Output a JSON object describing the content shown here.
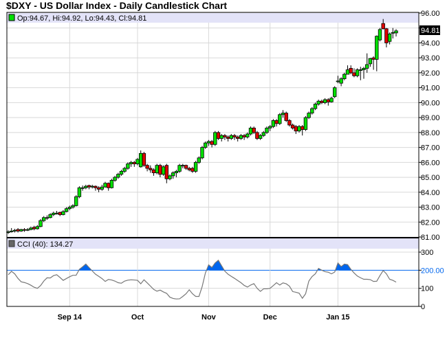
{
  "title": "$DXY - US Dollar Index - Daily Candlestick Chart",
  "colors": {
    "up": "#00e000",
    "down": "#e00000",
    "cci_line": "#777777",
    "cci_fill": "#0066ee",
    "ref_line": "#0066ee",
    "legend_bg": "#e3e3f8",
    "grid": "#d8d8d8"
  },
  "chart_data": [
    {
      "type": "candlestick",
      "title": "$DXY - US Dollar Index - Daily Candlestick Chart",
      "legend": "Op:94.67, Hi:94.92, Lo:94.43, Cl:94.81",
      "last_price_label": "94.81",
      "last_price": 94.81,
      "ylim": [
        81,
        96
      ],
      "yticks": [
        "81.00",
        "82.00",
        "83.00",
        "84.00",
        "85.00",
        "86.00",
        "87.00",
        "88.00",
        "89.00",
        "90.00",
        "91.00",
        "92.00",
        "93.00",
        "94.00",
        "95.00",
        "96.00"
      ],
      "grid": true,
      "xticks": [
        {
          "label": "Sep 14",
          "index": 19
        },
        {
          "label": "Oct",
          "index": 40
        },
        {
          "label": "Nov",
          "index": 62
        },
        {
          "label": "Dec",
          "index": 81
        },
        {
          "label": "Jan 15",
          "index": 102
        }
      ],
      "ohlc": [
        [
          81.3,
          81.45,
          81.2,
          81.35
        ],
        [
          81.35,
          81.6,
          81.3,
          81.4
        ],
        [
          81.4,
          81.55,
          81.3,
          81.45
        ],
        [
          81.5,
          81.6,
          81.3,
          81.4
        ],
        [
          81.4,
          81.55,
          81.35,
          81.5
        ],
        [
          81.5,
          81.6,
          81.35,
          81.45
        ],
        [
          81.45,
          81.6,
          81.4,
          81.5
        ],
        [
          81.5,
          81.7,
          81.45,
          81.6
        ],
        [
          81.65,
          81.75,
          81.45,
          81.55
        ],
        [
          81.55,
          81.8,
          81.5,
          81.7
        ],
        [
          81.7,
          82.2,
          81.65,
          82.1
        ],
        [
          82.1,
          82.4,
          82.0,
          82.3
        ],
        [
          82.3,
          82.45,
          82.15,
          82.3
        ],
        [
          82.3,
          82.6,
          82.25,
          82.5
        ],
        [
          82.5,
          82.7,
          82.4,
          82.6
        ],
        [
          82.6,
          82.75,
          82.5,
          82.6
        ],
        [
          82.65,
          82.7,
          82.4,
          82.5
        ],
        [
          82.5,
          82.8,
          82.45,
          82.7
        ],
        [
          82.7,
          83.0,
          82.65,
          82.9
        ],
        [
          82.9,
          83.1,
          82.8,
          83.0
        ],
        [
          83.0,
          83.2,
          82.9,
          83.1
        ],
        [
          83.1,
          83.8,
          83.05,
          83.7
        ],
        [
          83.7,
          84.4,
          83.6,
          84.3
        ],
        [
          84.3,
          84.45,
          84.1,
          84.3
        ],
        [
          84.3,
          84.5,
          84.2,
          84.4
        ],
        [
          84.45,
          84.5,
          84.2,
          84.35
        ],
        [
          84.35,
          84.5,
          84.25,
          84.4
        ],
        [
          84.4,
          84.45,
          84.1,
          84.3
        ],
        [
          84.3,
          84.4,
          84.0,
          84.2
        ],
        [
          84.2,
          84.5,
          84.1,
          84.35
        ],
        [
          84.35,
          84.7,
          84.3,
          84.6
        ],
        [
          84.6,
          84.65,
          84.1,
          84.3
        ],
        [
          84.3,
          84.9,
          84.25,
          84.8
        ],
        [
          84.8,
          85.1,
          84.7,
          85.0
        ],
        [
          85.0,
          85.3,
          84.9,
          85.2
        ],
        [
          85.2,
          85.5,
          85.1,
          85.4
        ],
        [
          85.4,
          85.7,
          85.3,
          85.6
        ],
        [
          85.6,
          86.0,
          85.5,
          85.9
        ],
        [
          85.9,
          86.1,
          85.7,
          86.0
        ],
        [
          86.0,
          86.1,
          85.7,
          85.9
        ],
        [
          85.9,
          86.3,
          85.8,
          86.2
        ],
        [
          85.7,
          86.8,
          85.65,
          86.6
        ],
        [
          86.6,
          86.7,
          85.7,
          85.8
        ],
        [
          85.8,
          85.9,
          85.4,
          85.6
        ],
        [
          85.6,
          85.8,
          85.3,
          85.5
        ],
        [
          85.5,
          85.6,
          85.1,
          85.3
        ],
        [
          85.3,
          85.9,
          85.2,
          85.8
        ],
        [
          85.8,
          85.9,
          85.0,
          85.2
        ],
        [
          85.2,
          85.8,
          85.1,
          85.7
        ],
        [
          85.8,
          85.9,
          84.6,
          84.9
        ],
        [
          84.9,
          85.2,
          84.8,
          85.1
        ],
        [
          85.1,
          85.4,
          84.9,
          85.3
        ],
        [
          85.3,
          85.5,
          85.0,
          85.4
        ],
        [
          85.4,
          85.9,
          85.3,
          85.8
        ],
        [
          85.8,
          85.9,
          85.6,
          85.8
        ],
        [
          85.8,
          85.85,
          85.5,
          85.6
        ],
        [
          85.6,
          85.7,
          85.4,
          85.5
        ],
        [
          85.6,
          85.7,
          85.3,
          85.4
        ],
        [
          85.4,
          86.1,
          85.3,
          86.0
        ],
        [
          86.0,
          86.4,
          85.9,
          86.3
        ],
        [
          86.3,
          87.1,
          86.2,
          87.0
        ],
        [
          87.0,
          87.4,
          86.9,
          87.3
        ],
        [
          87.3,
          87.5,
          87.1,
          87.4
        ],
        [
          87.4,
          87.5,
          87.0,
          87.2
        ],
        [
          87.2,
          88.1,
          87.1,
          88.0
        ],
        [
          88.0,
          88.1,
          87.5,
          87.6
        ],
        [
          87.6,
          87.9,
          87.4,
          87.8
        ],
        [
          87.8,
          87.9,
          87.5,
          87.7
        ],
        [
          87.7,
          87.8,
          87.4,
          87.6
        ],
        [
          87.6,
          87.9,
          87.5,
          87.8
        ],
        [
          87.8,
          87.9,
          87.5,
          87.7
        ],
        [
          87.7,
          87.8,
          87.4,
          87.6
        ],
        [
          87.6,
          87.9,
          87.5,
          87.8
        ],
        [
          87.8,
          87.9,
          87.5,
          87.7
        ],
        [
          87.7,
          88.0,
          87.6,
          87.9
        ],
        [
          87.9,
          88.4,
          87.8,
          88.3
        ],
        [
          88.3,
          88.4,
          87.9,
          88.0
        ],
        [
          88.0,
          88.1,
          87.5,
          87.6
        ],
        [
          87.6,
          87.9,
          87.5,
          87.8
        ],
        [
          87.8,
          88.1,
          87.7,
          88.0
        ],
        [
          88.0,
          88.4,
          87.9,
          88.3
        ],
        [
          88.3,
          88.5,
          88.1,
          88.4
        ],
        [
          88.4,
          88.9,
          88.3,
          88.8
        ],
        [
          88.8,
          88.9,
          88.4,
          88.6
        ],
        [
          88.6,
          89.3,
          88.5,
          89.2
        ],
        [
          89.2,
          89.5,
          89.0,
          89.3
        ],
        [
          89.3,
          89.4,
          88.7,
          88.8
        ],
        [
          88.8,
          88.9,
          88.4,
          88.5
        ],
        [
          88.5,
          88.6,
          88.2,
          88.3
        ],
        [
          88.4,
          88.5,
          87.9,
          88.1
        ],
        [
          88.1,
          88.5,
          88.0,
          88.4
        ],
        [
          88.4,
          88.5,
          87.8,
          88.2
        ],
        [
          88.2,
          89.1,
          88.1,
          89.0
        ],
        [
          89.0,
          89.4,
          88.9,
          89.3
        ],
        [
          89.3,
          89.7,
          89.2,
          89.6
        ],
        [
          89.6,
          90.0,
          89.5,
          89.9
        ],
        [
          89.9,
          90.2,
          89.8,
          90.1
        ],
        [
          90.1,
          90.2,
          89.9,
          90.0
        ],
        [
          90.0,
          90.3,
          89.9,
          90.2
        ],
        [
          90.2,
          90.3,
          89.8,
          90.05
        ],
        [
          90.05,
          90.4,
          90.0,
          90.3
        ],
        [
          90.4,
          91.1,
          90.3,
          91.0
        ],
        [
          91.4,
          91.8,
          91.3,
          91.45
        ],
        [
          91.3,
          91.7,
          91.1,
          91.6
        ],
        [
          91.6,
          92.0,
          91.5,
          91.9
        ],
        [
          91.9,
          92.5,
          91.9,
          92.2
        ],
        [
          92.3,
          92.5,
          91.9,
          92.0
        ],
        [
          92.0,
          92.3,
          91.7,
          91.8
        ],
        [
          91.8,
          92.3,
          91.7,
          92.2
        ],
        [
          92.2,
          92.4,
          91.5,
          92.2
        ],
        [
          92.2,
          92.4,
          91.6,
          92.3
        ],
        [
          92.3,
          93.3,
          92.0,
          92.55
        ],
        [
          92.6,
          93.0,
          92.4,
          92.95
        ],
        [
          93.0,
          93.1,
          92.2,
          92.9
        ],
        [
          92.9,
          94.5,
          92.1,
          94.45
        ],
        [
          94.2,
          95.0,
          94.1,
          94.9
        ],
        [
          95.3,
          95.6,
          94.9,
          94.95
        ],
        [
          94.95,
          95.0,
          93.7,
          94.0
        ],
        [
          94.1,
          94.7,
          93.9,
          94.6
        ],
        [
          94.65,
          95.0,
          94.3,
          94.7
        ],
        [
          94.67,
          94.92,
          94.43,
          94.81
        ]
      ]
    },
    {
      "type": "line",
      "legend": "CCI (40): 134.27",
      "ylim": [
        0,
        300
      ],
      "yticks": [
        "0",
        "100",
        "200.00",
        "300"
      ],
      "reference_level": 200,
      "fill_above_reference": true,
      "values": [
        175,
        194,
        180,
        155,
        136,
        132,
        126,
        117,
        106,
        100,
        115,
        140,
        158,
        157,
        170,
        175,
        160,
        144,
        154,
        164,
        172,
        172,
        205,
        219,
        234,
        215,
        196,
        178,
        166,
        154,
        138,
        149,
        146,
        140,
        131,
        128,
        140,
        145,
        147,
        146,
        144,
        125,
        147,
        130,
        112,
        94,
        84,
        90,
        80,
        72,
        51,
        44,
        41,
        42,
        55,
        70,
        92,
        70,
        55,
        55,
        110,
        185,
        230,
        215,
        240,
        255,
        225,
        195,
        178,
        166,
        155,
        143,
        131,
        116,
        107,
        118,
        126,
        100,
        83,
        97,
        97,
        100,
        115,
        131,
        118,
        130,
        125,
        112,
        82,
        78,
        73,
        45,
        70,
        140,
        165,
        180,
        210,
        200,
        192,
        189,
        180,
        190,
        240,
        220,
        234,
        231,
        205,
        185,
        168,
        158,
        150,
        150,
        148,
        138,
        139,
        170,
        198,
        180,
        150,
        144,
        134.27
      ]
    }
  ]
}
